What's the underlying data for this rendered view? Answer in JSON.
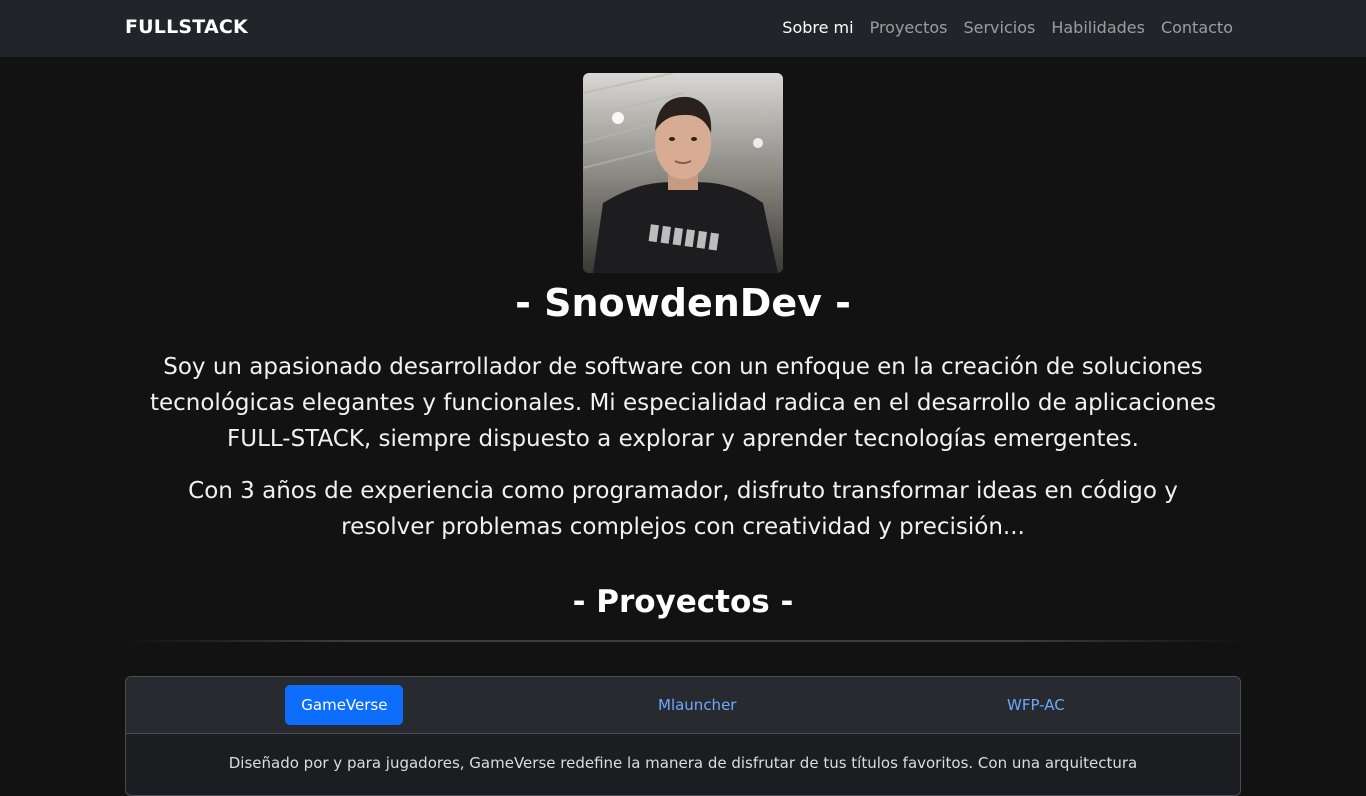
{
  "navbar": {
    "brand": "FULLSTACK",
    "links": [
      {
        "label": "Sobre mi",
        "active": true
      },
      {
        "label": "Proyectos",
        "active": false
      },
      {
        "label": "Servicios",
        "active": false
      },
      {
        "label": "Habilidades",
        "active": false
      },
      {
        "label": "Contacto",
        "active": false
      }
    ]
  },
  "hero": {
    "name": "- SnowdenDev -",
    "paragraph1": "Soy un apasionado desarrollador de software con un enfoque en la creación de soluciones tecnológicas elegantes y funcionales. Mi especialidad radica en el desarrollo de aplicaciones FULL-STACK, siempre dispuesto a explorar y aprender tecnologías emergentes.",
    "paragraph2": "Con 3 años de experiencia como programador, disfruto transformar ideas en código y resolver problemas complejos con creatividad y precisión..."
  },
  "projects": {
    "title": "- Proyectos -",
    "tabs": [
      {
        "label": "GameVerse",
        "active": true
      },
      {
        "label": "Mlauncher",
        "active": false
      },
      {
        "label": "WFP-AC",
        "active": false
      }
    ],
    "description": "Diseñado por y para jugadores, GameVerse redefine la manera de disfrutar de tus títulos favoritos. Con una arquitectura"
  },
  "colors": {
    "background": "#121212",
    "navbar": "#212529",
    "accent": "#0d6efd",
    "link": "#6ea8fe"
  }
}
